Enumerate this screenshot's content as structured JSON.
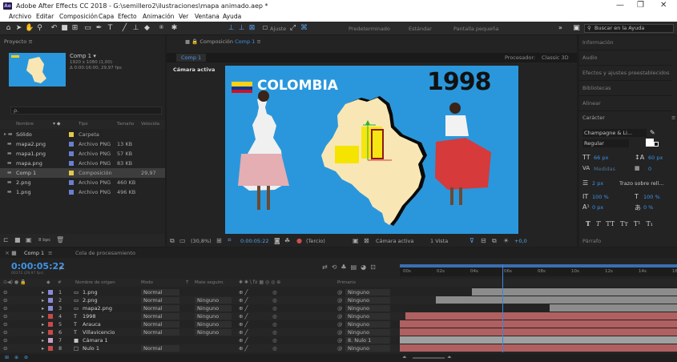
{
  "window": {
    "title": "Adobe After Effects CC 2018 - G:\\semillero2\\ilustraciones\\mapa animado.aep *",
    "logo": "Ae",
    "minimize": "—",
    "restore": "❐",
    "close": "✕"
  },
  "menu": [
    "Archivo",
    "Editar",
    "Composición",
    "Capa",
    "Efecto",
    "Animación",
    "Ver",
    "Ventana",
    "Ayuda"
  ],
  "toolbar": {
    "snap_label": "Ajuste",
    "workspaces": [
      "Predeterminado",
      "Estándar",
      "Pantalla pequeña"
    ],
    "more": "»",
    "search_placeholder": "Buscar en la Ayuda"
  },
  "project": {
    "tab": "Proyecto",
    "menu": "≡",
    "comp_name": "Comp 1 ▾",
    "comp_res": "1920 x 1080 (1,00)",
    "comp_dur": "Δ 0:00:16:00, 29,97 fps",
    "search_icon": "ρ.",
    "columns": [
      "Nombre",
      "Tipo",
      "Tamaño",
      "Velocida"
    ],
    "items": [
      {
        "name": "Sólido",
        "type": "Carpeta",
        "size": "",
        "speed": "",
        "color": "#e4c84a"
      },
      {
        "name": "mapa2.png",
        "type": "Archivo PNG",
        "size": "13 KB",
        "speed": "",
        "color": "#6a7fd0"
      },
      {
        "name": "mapa1.png",
        "type": "Archivo PNG",
        "size": "57 KB",
        "speed": "",
        "color": "#6a7fd0"
      },
      {
        "name": "mapa.png",
        "type": "Archivo PNG",
        "size": "83 KB",
        "speed": "",
        "color": "#6a7fd0"
      },
      {
        "name": "Comp 1",
        "type": "Composición",
        "size": "",
        "speed": "29,97",
        "color": "#e4c84a"
      },
      {
        "name": "2.png",
        "type": "Archivo PNG",
        "size": "460 KB",
        "speed": "",
        "color": "#6a7fd0"
      },
      {
        "name": "1.png",
        "type": "Archivo PNG",
        "size": "496 KB",
        "speed": "",
        "color": "#6a7fd0"
      }
    ],
    "footer_bpc": "8 bpc"
  },
  "composition": {
    "tab": "Composición",
    "tab_comp": "Comp 1",
    "menu": "≡",
    "sub_tab": "Comp 1",
    "renderer_label": "Procesador:",
    "renderer": "Classic 3D",
    "active_camera": "Cámara activa",
    "frame": {
      "bg": "#2a97dc",
      "flag_colors": [
        "#fcd116",
        "#003893",
        "#ce1126"
      ],
      "country": "COLOMBIA",
      "year": "1998"
    },
    "footer": {
      "zoom": "(30,8%)",
      "timecode": "0:00:05:22",
      "resolution": "(Tercio)",
      "camera": "Cámara activa",
      "views": "1 Vista",
      "exposure": "+0,0"
    }
  },
  "right": {
    "items": [
      "Información",
      "Audio",
      "Efectos y ajustes preestablecidos",
      "Bibliotecas",
      "Alinear"
    ],
    "character": {
      "title": "Carácter",
      "menu": "≡",
      "font": "Champagne & Li...",
      "style": "Regular",
      "size": "66 px",
      "leading": "60 px",
      "kerning": "Medidas",
      "tracking": "0",
      "stroke": "2 px",
      "stroke_mode": "Trazo sobre rell...",
      "v_scale": "100 %",
      "h_scale": "100 %",
      "baseline": "0 px",
      "tsume": "0 %",
      "styles": [
        "T",
        "T",
        "TT",
        "Tт",
        "T¹",
        "T₁"
      ]
    },
    "paragraph": "Párrafo"
  },
  "timeline": {
    "tab": "Comp 1",
    "menu": "≡",
    "render_queue": "Cola de procesamiento",
    "timecode": "0:00:05:22",
    "timecode_sub": "00172 (29,97 fps)",
    "search_icon": "ρ.",
    "ruler": [
      "00s",
      "02s",
      "04s",
      "06s",
      "08s",
      "10s",
      "12s",
      "14s",
      "16s"
    ],
    "columns": {
      "num": "#",
      "name": "Nombre de origen",
      "mode": "Modo",
      "t": "T",
      "matte": "Mate seguim.",
      "switches": "✱ ✱ \\ fx ▦ ◎ ◎ ⊕",
      "parent": "Primario"
    },
    "layers": [
      {
        "num": "1",
        "name": "1.png",
        "mode": "Normal",
        "matte": "",
        "parent": "Ninguno",
        "color": "#8a8ad8",
        "icon": "img",
        "bar_color": "#8c8c8c",
        "bar_start": 0.26,
        "bar_end": 1.0
      },
      {
        "num": "2",
        "name": "2.png",
        "mode": "Normal",
        "matte": "Ninguno",
        "parent": "Ninguno",
        "color": "#8a8ad8",
        "icon": "img",
        "bar_color": "#8c8c8c",
        "bar_start": 0.13,
        "bar_end": 1.0
      },
      {
        "num": "3",
        "name": "mapa2.png",
        "mode": "Normal",
        "matte": "Ninguno",
        "parent": "Ninguno",
        "color": "#8a8ad8",
        "icon": "img",
        "bar_color": "#8c8c8c",
        "bar_start": 0.54,
        "bar_end": 1.0
      },
      {
        "num": "4",
        "name": "1998",
        "mode": "Normal",
        "matte": "Ninguno",
        "parent": "Ninguno",
        "color": "#c94a4a",
        "icon": "text",
        "bar_color": "#b06060",
        "bar_start": 0.02,
        "bar_end": 1.0
      },
      {
        "num": "5",
        "name": "Arauca",
        "mode": "Normal",
        "matte": "Ninguno",
        "parent": "Ninguno",
        "color": "#c94a4a",
        "icon": "text",
        "bar_color": "#b06060",
        "bar_start": 0.0,
        "bar_end": 1.0
      },
      {
        "num": "6",
        "name": "Villavicencio",
        "mode": "Normal",
        "matte": "Ninguno",
        "parent": "Ninguno",
        "color": "#c94a4a",
        "icon": "text",
        "bar_color": "#b06060",
        "bar_start": 0.0,
        "bar_end": 1.0
      },
      {
        "num": "7",
        "name": "Cámara 1",
        "mode": "",
        "matte": "",
        "parent": "8. Nulo 1",
        "color": "#c9a0c9",
        "icon": "cam",
        "bar_color": "#a0a0a0",
        "bar_start": 0.0,
        "bar_end": 1.0
      },
      {
        "num": "8",
        "name": "Nulo 1",
        "mode": "Normal",
        "matte": "",
        "parent": "Ninguno",
        "color": "#c94a4a",
        "icon": "null",
        "bar_color": "#b06060",
        "bar_start": 0.0,
        "bar_end": 1.0
      }
    ],
    "playhead": 0.37
  }
}
